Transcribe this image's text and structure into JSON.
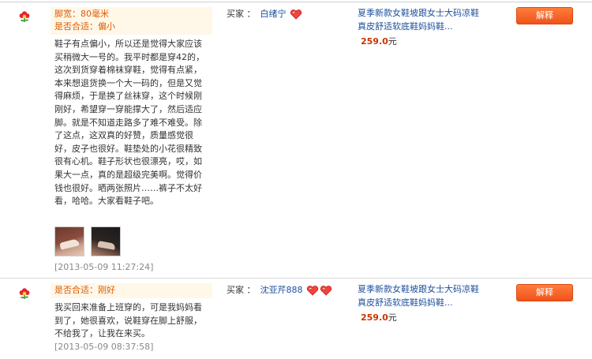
{
  "reviews": [
    {
      "attributes": [
        {
          "key": "脚宽：",
          "value": "80毫米"
        },
        {
          "key": "是否合适：",
          "value": "偏小"
        }
      ],
      "text": "鞋子有点偏小，所以还是觉得大家应该买稍微大一号的。我平时都是穿42的，这次到货穿着棉袜穿鞋，觉得有点紧，本来想退货换一个大一码的，但是又觉得麻烦，于是换了丝袜穿，这个时候刚刚好，希望穿一穿能撑大了，然后适应脚。就是不知道走路多了难不难受。除了这点，这双真的好赞，质量感觉很好，皮子也很好。鞋垫处的小花很精致很有心机。鞋子形状也很漂亮，哎，如果大一点，真的是超级完美啊。觉得价钱也很好。晒两张照片……裤子不太好看，哈哈。大家看鞋子吧。",
      "date": "[2013-05-09 11:27:24]",
      "buyer_label": "买家 ：",
      "buyer_name": "白绪宁",
      "hearts": 1,
      "product_title": "夏季新款女鞋坡跟女士大码凉鞋真皮舒适软底鞋妈妈鞋...",
      "price": "259.0",
      "currency": "元",
      "button_label": "解释"
    },
    {
      "attributes": [
        {
          "key": "是否合适：",
          "value": "刚好"
        }
      ],
      "text": "我买回来准备上班穿的，可是我妈妈看到了，她很喜欢，说鞋穿在脚上舒服，不给我了，让我在来买。",
      "date": "[2013-05-09 08:37:58]",
      "buyer_label": "买家 ：",
      "buyer_name": "沈亚芹888",
      "hearts": 2,
      "product_title": "夏季新款女鞋坡跟女士大码凉鞋真皮舒适软底鞋妈妈鞋...",
      "price": "259.0",
      "currency": "元",
      "button_label": "解释"
    }
  ],
  "icons": {
    "rating": "red-flower-icon",
    "buyer_level": "heart-icon",
    "photo": "review-photo-thumbnail"
  },
  "colors": {
    "accent_orange": "#e05a00",
    "link_blue": "#1c4f9c",
    "price_red": "#cc3300",
    "button_orange": "#f0521a"
  }
}
